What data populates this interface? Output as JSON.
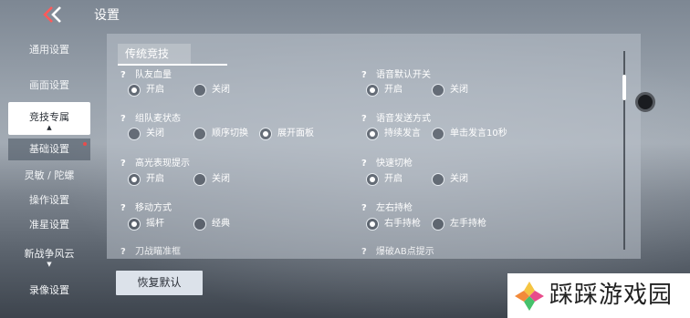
{
  "header": {
    "title": "设置",
    "back_icon": "back-chevron-icon"
  },
  "sidebar": {
    "items": [
      {
        "label": "通用设置"
      },
      {
        "label": "画面设置"
      },
      {
        "label": "竞技专属",
        "active": true
      },
      {
        "label": "基础设置",
        "sub": true
      },
      {
        "label": "灵敏 / 陀螺"
      },
      {
        "label": "操作设置"
      },
      {
        "label": "准星设置"
      },
      {
        "label": "新战争风云"
      },
      {
        "label": "录像设置"
      }
    ]
  },
  "main": {
    "tab": "传统竞技",
    "left": {
      "s0": {
        "title": "队友血量",
        "options": [
          "开启",
          "关闭"
        ],
        "selected": 0
      },
      "s1": {
        "title": "组队麦状态",
        "options": [
          "关闭",
          "顺序切换",
          "展开面板"
        ],
        "selected": 2
      },
      "s2": {
        "title": "高光表现提示",
        "options": [
          "开启",
          "关闭"
        ],
        "selected": 0
      },
      "s3": {
        "title": "移动方式",
        "options": [
          "摇杆",
          "经典"
        ],
        "selected": 0
      },
      "s4": {
        "title": "刀战瞄准框"
      }
    },
    "right": {
      "s0": {
        "title": "语音默认开关",
        "options": [
          "开启",
          "关闭"
        ],
        "selected": 0
      },
      "s1": {
        "title": "语音发送方式",
        "options": [
          "持续发言",
          "单击发言10秒"
        ],
        "selected": 0
      },
      "s2": {
        "title": "快速切枪",
        "options": [
          "开启",
          "关闭"
        ],
        "selected": 0
      },
      "s3": {
        "title": "左右持枪",
        "options": [
          "右手持枪",
          "左手持枪"
        ],
        "selected": 0
      },
      "s4": {
        "title": "爆破AB点提示"
      }
    },
    "restore_label": "恢复默认"
  },
  "watermark": {
    "text": "踩踩游戏园"
  },
  "colors": {
    "accent": "#ffffff",
    "active_nav_bg": "#ffffff",
    "badge": "#e84c4c"
  }
}
